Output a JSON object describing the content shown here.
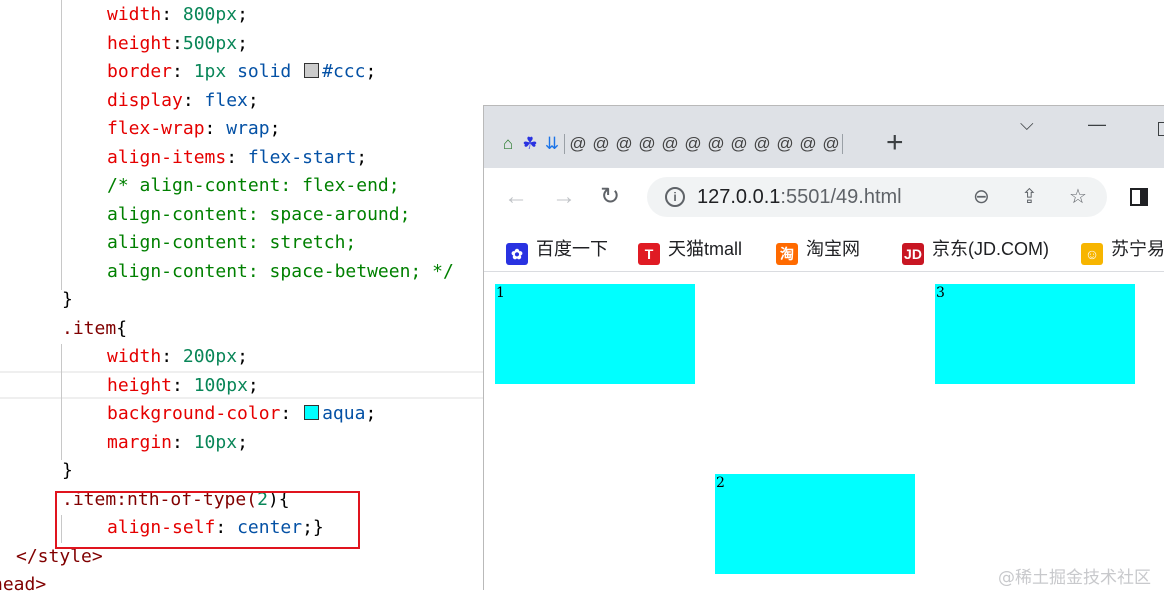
{
  "editor": {
    "lines": {
      "l1": {
        "prop": "width",
        "num": "800px"
      },
      "l2": {
        "prop": "height",
        "num": "500px"
      },
      "l3": {
        "prop": "border",
        "num": "1px",
        "val1": "solid",
        "color": "#ccc"
      },
      "l4": {
        "prop": "display",
        "val": "flex"
      },
      "l5": {
        "prop": "flex-wrap",
        "val": "wrap"
      },
      "l6": {
        "prop": "align-items",
        "val": "flex-start"
      },
      "l7": {
        "comment": "/* align-content: flex-end;"
      },
      "l8": {
        "comment": "align-content: space-around;"
      },
      "l9": {
        "comment": "align-content: stretch;"
      },
      "l10": {
        "comment": "align-content: space-between; */"
      },
      "l11": {
        "text": "}"
      },
      "l12": {
        "sel": ".item",
        "punc": "{"
      },
      "l13": {
        "prop": "width",
        "num": "200px"
      },
      "l14": {
        "prop": "height",
        "num": "100px"
      },
      "l15": {
        "prop": "background-color",
        "val": "aqua"
      },
      "l16": {
        "prop": "margin",
        "num": "10px"
      },
      "l17": {
        "text": "}"
      },
      "l18": {
        "sel": ".item:nth-of-type(",
        "num": "2",
        "punc": "){"
      },
      "l19": {
        "prop": "align-self",
        "val": "center",
        "punc": ";}"
      },
      "l20": {
        "tag": "</style>"
      },
      "l21": {
        "tag": "head>"
      }
    },
    "swatch_colors": {
      "ccc": "#cccccc",
      "aqua": "#00ffff"
    }
  },
  "browser": {
    "tab_favicons": [
      "home-ie-icon",
      "baidu-paw-icon",
      "download-icon",
      "generic-tab-icon"
    ],
    "new_tab": "+",
    "window_controls": {
      "menu": "⌵",
      "minimize": "—"
    },
    "url_host": "127.0.0.1",
    "url_rest": ":5501/49.html",
    "bookmarks": [
      {
        "label": "百度一下",
        "icon": "baidu-icon"
      },
      {
        "label": "天猫tmall",
        "icon": "tmall-icon"
      },
      {
        "label": "淘宝网",
        "icon": "taobao-icon"
      },
      {
        "label": "京东(JD.COM)",
        "icon": "jd-icon"
      },
      {
        "label": "苏宁易",
        "icon": "suning-icon"
      }
    ],
    "items": [
      {
        "label": "1"
      },
      {
        "label": "3"
      },
      {
        "label": "2"
      }
    ],
    "item_color": "#00ffff"
  },
  "watermark": "@稀土掘金技术社区"
}
